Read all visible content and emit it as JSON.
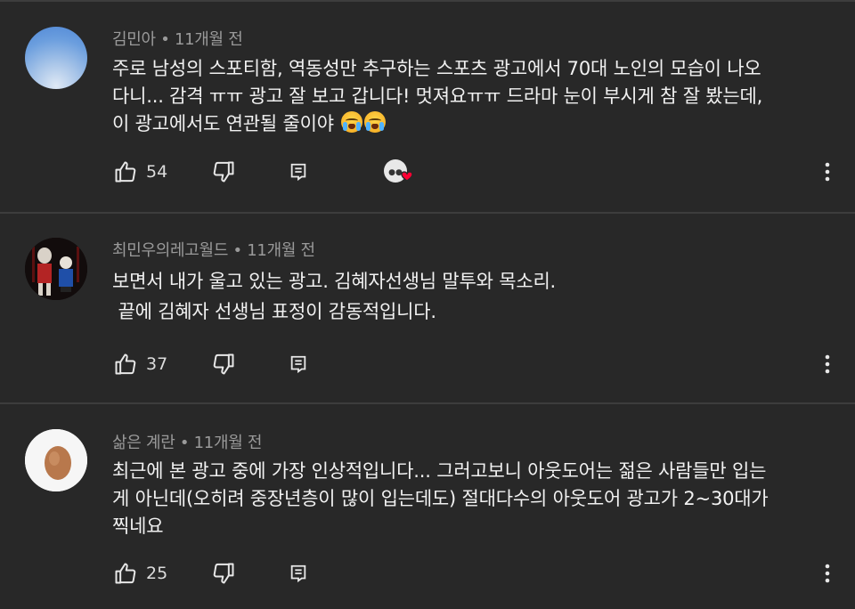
{
  "comments": [
    {
      "author": "김민아",
      "time": "11개월 전",
      "lines": [
        "주로 남성의 스포티함, 역동성만 추구하는 스포츠 광고에서 70대 노인의 모습이 나오",
        "다니... 감격 ㅠㅠ 광고 잘 보고 갑니다! 멋져요ㅠㅠ 드라마 눈이 부시게 참 잘 봤는데,",
        "이 광고에서도 연관될 줄이야"
      ],
      "emoji": [
        "loudly-crying-face-icon",
        "loudly-crying-face-icon"
      ],
      "likes": "54",
      "creator_heart": true
    },
    {
      "author": "최민우의레고월드",
      "time": "11개월 전",
      "lines": [
        "보면서 내가 울고 있는 광고. 김혜자선생님 말투와 목소리.",
        " 끝에 김혜자 선생님 표정이 감동적입니다."
      ],
      "likes": "37",
      "creator_heart": false
    },
    {
      "author": "삶은 계란",
      "time": "11개월 전",
      "lines": [
        "최근에 본 광고 중에 가장 인상적입니다... 그러고보니 아웃도어는 젊은 사람들만 입는",
        "게 아닌데(오히려 중장년층이 많이 입는데도) 절대다수의 아웃도어 광고가 2~30대가",
        "찍네요"
      ],
      "likes": "25",
      "creator_heart": false
    }
  ],
  "separator": "•",
  "icons": {
    "like": "thumbs-up-icon",
    "dislike": "thumbs-down-icon",
    "reply": "reply-comment-icon",
    "more": "more-vertical-icon",
    "heart": "creator-heart-icon"
  },
  "colors": {
    "background": "#282828",
    "text": "#f1f1f1",
    "meta": "#9a9a9a",
    "heart": "#ff0033"
  }
}
